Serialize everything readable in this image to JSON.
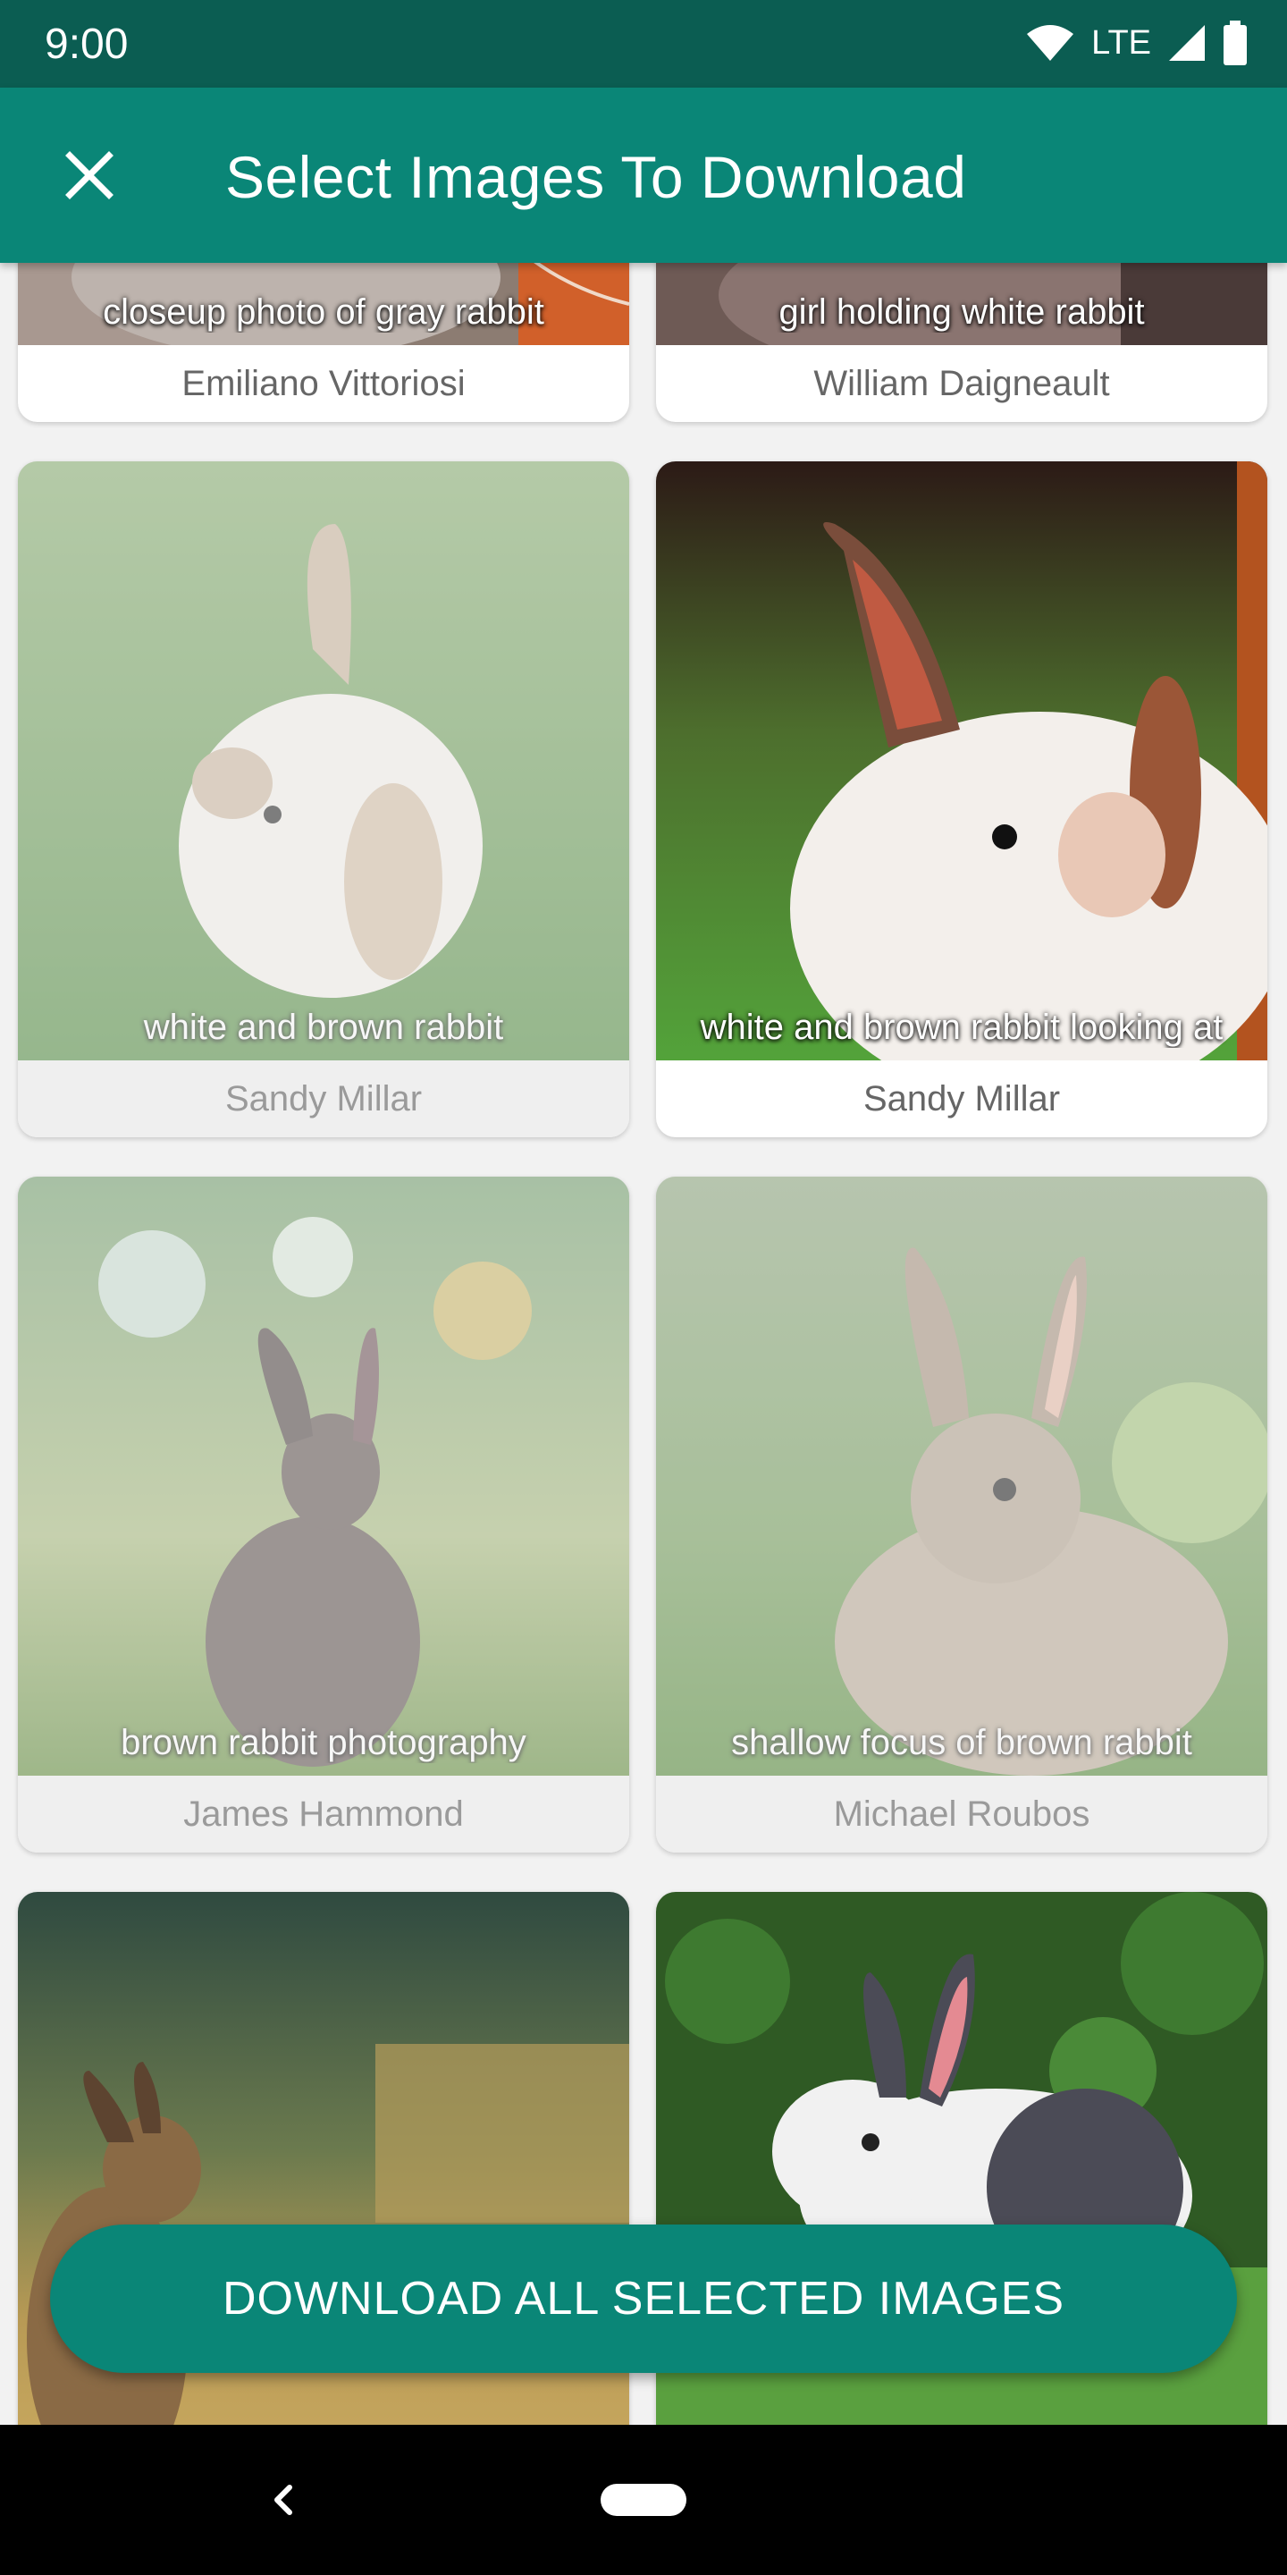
{
  "status": {
    "time": "9:00",
    "network": "LTE"
  },
  "app_bar": {
    "title": "Select Images To Download",
    "close_icon": "close-icon"
  },
  "cards": [
    {
      "caption": "closeup photo of gray rabbit",
      "author": "Emiliano Vittoriosi",
      "selected": true
    },
    {
      "caption": "girl holding white rabbit",
      "author": "William Daigneault",
      "selected": true
    },
    {
      "caption": "white and brown rabbit",
      "author": "Sandy Millar",
      "selected": false
    },
    {
      "caption": "white and brown rabbit looking at",
      "author": "Sandy Millar",
      "selected": true
    },
    {
      "caption": "brown rabbit photography",
      "author": "James Hammond",
      "selected": false
    },
    {
      "caption": "shallow focus of brown rabbit",
      "author": "Michael Roubos",
      "selected": false
    },
    {
      "caption": "",
      "author": "",
      "selected": true
    },
    {
      "caption": "",
      "author": "",
      "selected": true
    }
  ],
  "download_button": {
    "label": "DOWNLOAD ALL SELECTED IMAGES"
  },
  "colors": {
    "status_bar": "#0b5d52",
    "app_bar": "#0a8677",
    "button": "#0a8677"
  }
}
